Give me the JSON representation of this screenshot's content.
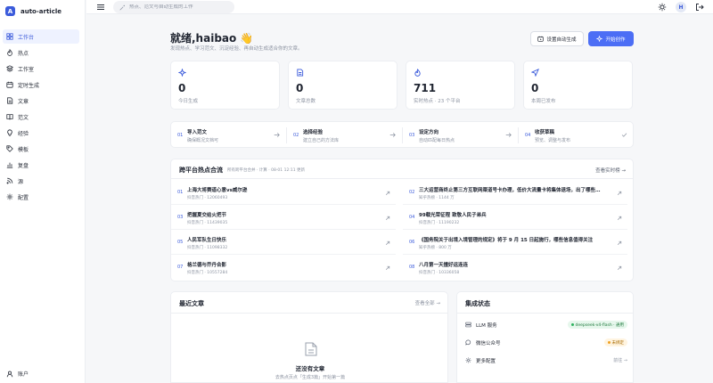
{
  "brand": {
    "logo_letter": "A",
    "name": "auto-article"
  },
  "sidebar": {
    "items": [
      {
        "label": "工作台",
        "icon": "grid-icon",
        "active": true
      },
      {
        "label": "热点",
        "icon": "flame-icon",
        "active": false
      },
      {
        "label": "工作室",
        "icon": "layers-icon",
        "active": false
      },
      {
        "label": "定时生成",
        "icon": "calendar-icon",
        "active": false
      },
      {
        "label": "文章",
        "icon": "document-icon",
        "active": false
      },
      {
        "label": "范文",
        "icon": "book-icon",
        "active": false
      },
      {
        "label": "经验",
        "icon": "lightbulb-icon",
        "active": false
      },
      {
        "label": "模板",
        "icon": "tag-icon",
        "active": false
      },
      {
        "label": "复盘",
        "icon": "bar-chart-icon",
        "active": false
      },
      {
        "label": "源",
        "icon": "rss-icon",
        "active": false
      },
      {
        "label": "配置",
        "icon": "gear-icon",
        "active": false
      }
    ],
    "account_label": "账户"
  },
  "topbar": {
    "search_placeholder": "热点、范文与自动生成的工作",
    "avatar_letter": "H"
  },
  "header": {
    "greeting": "就绪,haibao 👋",
    "subtitle": "发现热点、学习范文、沉淀经验、再自动生成适合你的文章。",
    "schedule_btn": "设置自动生成",
    "start_btn": "开始创作"
  },
  "stats": [
    {
      "value": "0",
      "label": "今日生成",
      "icon": "sparkle-icon"
    },
    {
      "value": "0",
      "label": "文章总数",
      "icon": "document-icon"
    },
    {
      "value": "711",
      "label": "实时热点 · 23 个平台",
      "icon": "flame-icon"
    },
    {
      "value": "0",
      "label": "本周已发布",
      "icon": "send-icon"
    }
  ],
  "steps": [
    {
      "num": "01",
      "title": "导入范文",
      "desc": "确保概况文档可"
    },
    {
      "num": "02",
      "title": "选择经验",
      "desc": "建立自己的方法库"
    },
    {
      "num": "03",
      "title": "设定方向",
      "desc": "自动匹配每日热点"
    },
    {
      "num": "04",
      "title": "收获草稿",
      "desc": "预览、调整与发布"
    }
  ],
  "hot": {
    "title": "跨平台热点合流",
    "meta": "所有跨平台合并 · 计算 · 08-01 12:11 更新",
    "link": "查看实时榜 →",
    "items": [
      {
        "rank": "01",
        "title": "上海大将赛道心意vs威尔逊",
        "sub": "抖音热门 · 12060493"
      },
      {
        "rank": "02",
        "title": "三大运营商终止第三方互联网渠道号卡办理，低价大流量卡将集体退场，出了哪些…",
        "sub": "知乎热榜 · 1144 万"
      },
      {
        "rank": "03",
        "title": "把握夏交给火把节",
        "sub": "抖音热门 · 11439035"
      },
      {
        "rank": "04",
        "title": "99载光荣征程 致敬人民子弟兵",
        "sub": "抖音热门 · 11190232"
      },
      {
        "rank": "05",
        "title": "人民军队生日快乐",
        "sub": "抖音热门 · 11098332"
      },
      {
        "rank": "06",
        "title": "《国务院关于出境入境管理的规定》将于 9 月 15 日起施行，哪些信息值得关注",
        "sub": "知乎热榜 · 800 万"
      },
      {
        "rank": "07",
        "title": "格兰德与乔丹合影",
        "sub": "抖音热门 · 10557284"
      },
      {
        "rank": "08",
        "title": "八月第一天撞好运连连",
        "sub": "抖音热门 · 10336058"
      }
    ]
  },
  "recent": {
    "title": "最近文章",
    "link": "查看全部 →",
    "empty_title": "还没有文章",
    "empty_desc": "去热点页点「生成3篇」开始第一篇"
  },
  "integrations": {
    "title": "集成状态",
    "rows": [
      {
        "label": "LLM 服务",
        "icon": "server-icon",
        "badge": "deepseek-v4-flash · 通用",
        "status": "green"
      },
      {
        "label": "微信公众号",
        "icon": "chat-icon",
        "badge": "未绑定",
        "status": "amber"
      },
      {
        "label": "更多配置",
        "icon": "gear-icon",
        "manage": "前往 →"
      }
    ]
  }
}
